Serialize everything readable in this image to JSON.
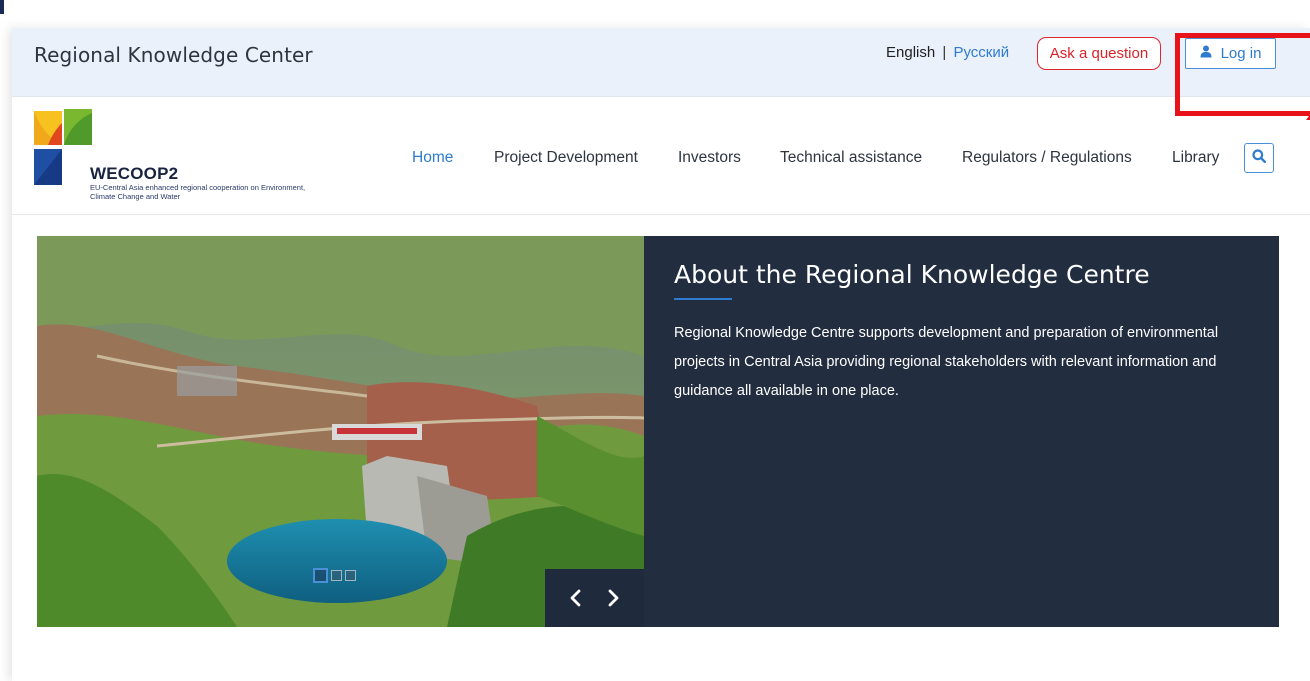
{
  "header": {
    "site_title": "Regional Knowledge Center",
    "lang_english": "English",
    "lang_separator": "|",
    "lang_russian": "Русский",
    "ask_label": "Ask a question",
    "login_label": "Log in"
  },
  "logo": {
    "name": "WECOOP2",
    "tagline": "EU-Central Asia enhanced regional cooperation on Environment, Climate Change and Water"
  },
  "nav": {
    "items": [
      {
        "label": "Home",
        "active": true
      },
      {
        "label": "Project Development",
        "active": false
      },
      {
        "label": "Investors",
        "active": false
      },
      {
        "label": "Technical assistance",
        "active": false
      },
      {
        "label": "Regulators / Regulations",
        "active": false
      },
      {
        "label": "Library",
        "active": false
      }
    ],
    "search_icon": "search-icon"
  },
  "hero": {
    "title": "About the Regional Knowledge Centre",
    "body": "Regional Knowledge Centre supports development and preparation of environmental projects in Central Asia providing regional stakeholders with relevant information and guidance all available in one place.",
    "image_description_icon": "landscape-photo",
    "slides_total": 3,
    "slide_active": 1
  },
  "colors": {
    "accent": "#2f7bd0",
    "ask_red": "#d8232a",
    "panel_bg": "#222d40",
    "topbar_bg": "#eaf1fb",
    "highlight": "#e8131a"
  }
}
